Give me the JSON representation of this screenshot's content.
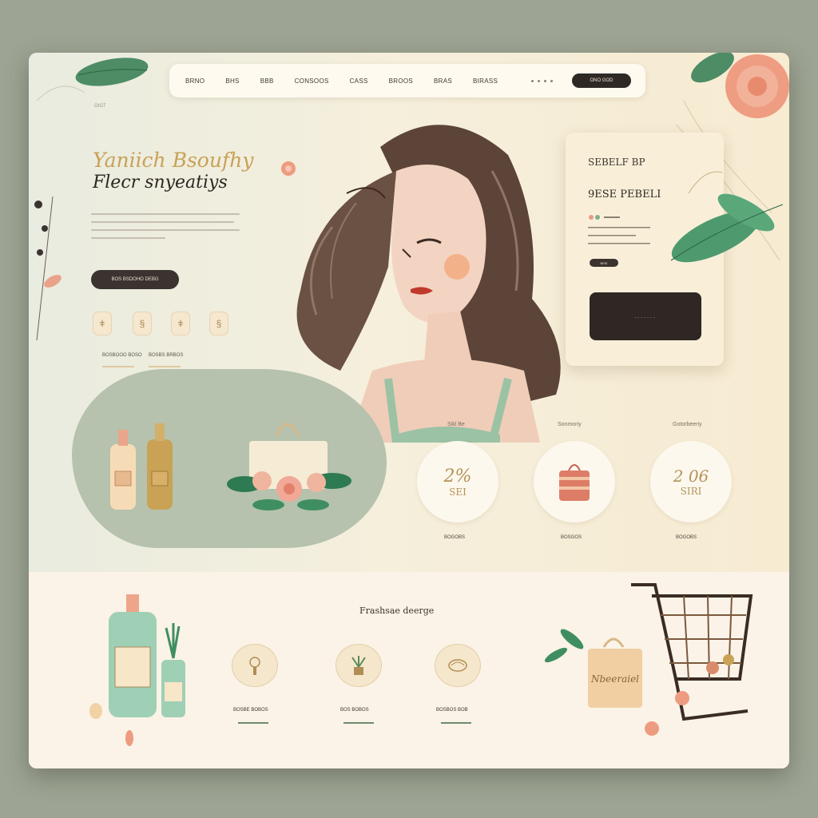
{
  "nav": {
    "links": [
      "BRNO",
      "BHS",
      "BBB",
      "CONSOOS",
      "CASS",
      "BROOS",
      "BRAS",
      "BIRASS"
    ],
    "cta": "ONO GOD"
  },
  "corner_label": "GIGT",
  "hero": {
    "title_line1": "Yaniich Bsoufhy",
    "title_line2": "Flecr snyeatiys",
    "cta": "BOS BSDOHO DEBG",
    "stats": [
      "BOSBOOO BOSO",
      "BOSBS BRBOS"
    ]
  },
  "card": {
    "title": "SEBELF BP",
    "subtitle": "9ESE PEBELI",
    "small_btn": "BISE",
    "submit": "......."
  },
  "circles": [
    {
      "top": "Sikl Be",
      "line1": "2%",
      "line2": "SEI",
      "bottom": "BOGOBS"
    },
    {
      "top": "Sonmoriy",
      "line1": "",
      "line2": "",
      "bottom": "BOSGOS"
    },
    {
      "top": "Gotorbeeriy",
      "line1": "2 06",
      "line2": "SIRI",
      "bottom": "BOGOBS"
    }
  ],
  "bottom": {
    "title": "Frashsae deerge",
    "badges": [
      "BOSBE BOBOS",
      "BOS BOBOS",
      "BOSBOS BOB"
    ],
    "bag_text": "Nbeeraiel"
  },
  "colors": {
    "accent_gold": "#c9a157",
    "dark": "#2e2723",
    "sage": "#b6c2ad",
    "leaf_green": "#4f8a66",
    "peach": "#e79b84"
  }
}
